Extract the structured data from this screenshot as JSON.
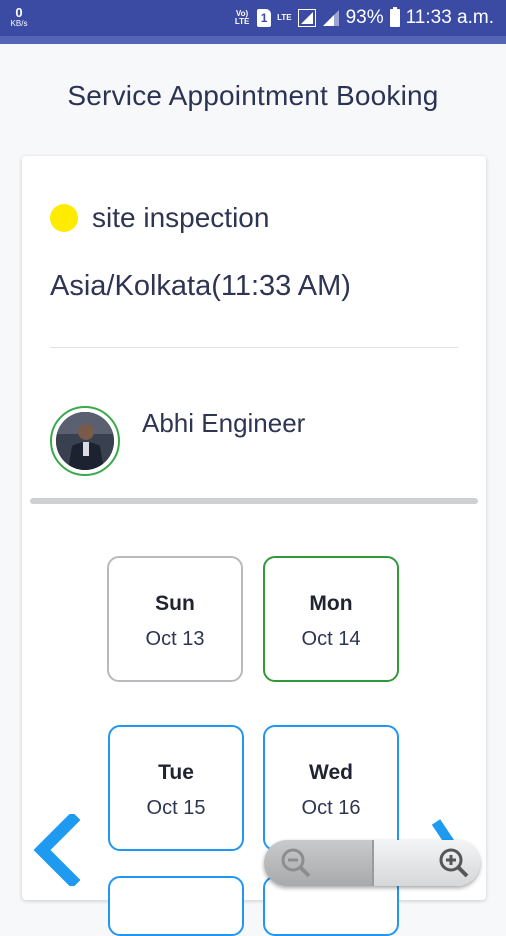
{
  "status_bar": {
    "kb_value": "0",
    "kb_unit": "KB/s",
    "volte_label": "Vo) LTE",
    "sim_label": "1",
    "lte_label": "LTE",
    "battery": "93%",
    "time": "11:33 a.m."
  },
  "header": {
    "title": "Service Appointment Booking"
  },
  "service": {
    "name": "site inspection",
    "color": "#ffeb00",
    "timezone": "Asia/Kolkata(11:33 AM)"
  },
  "engineer": {
    "name": "Abhi Engineer"
  },
  "days": [
    {
      "weekday": "Sun",
      "date": "Oct 13",
      "state": "disabled"
    },
    {
      "weekday": "Mon",
      "date": "Oct 14",
      "state": "selected"
    },
    {
      "weekday": "Tue",
      "date": "Oct 15",
      "state": "available"
    },
    {
      "weekday": "Wed",
      "date": "Oct 16",
      "state": "available"
    }
  ],
  "colors": {
    "accent_blue": "#2196f3",
    "selected_green": "#2f9a37",
    "status_bar": "#3b4ba3"
  },
  "icons": {
    "prev": "chevron-left-icon",
    "next": "chevron-right-icon",
    "zoom_out": "zoom-out-icon",
    "zoom_in": "zoom-in-icon"
  }
}
